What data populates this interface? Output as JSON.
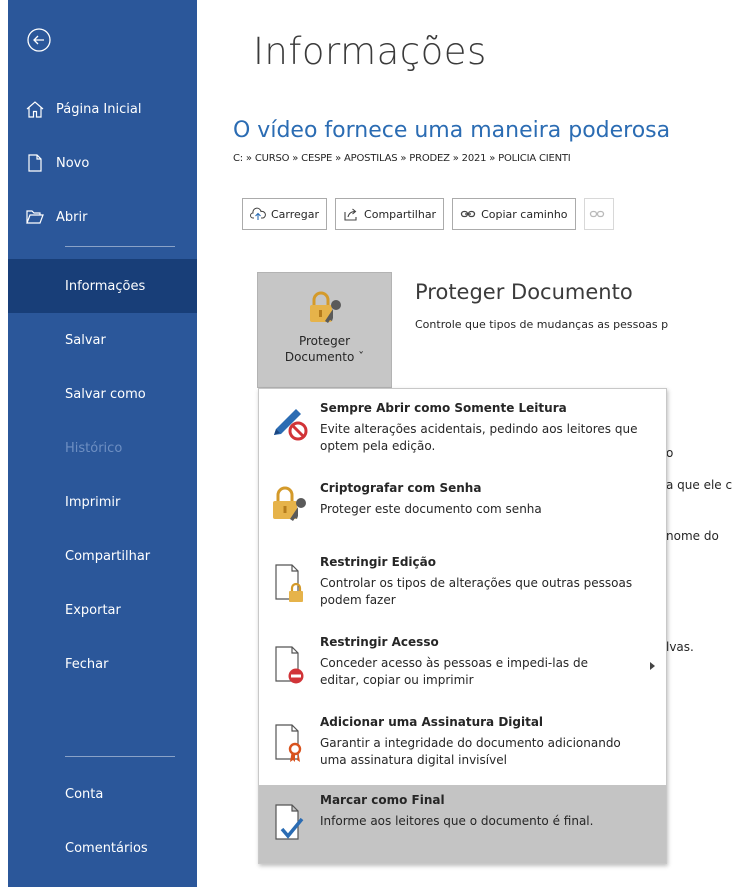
{
  "sidebar": {
    "back_icon": "back-arrow-icon",
    "top_items": [
      {
        "label": "Página Inicial",
        "icon": "home-icon"
      },
      {
        "label": "Novo",
        "icon": "new-document-icon"
      },
      {
        "label": "Abrir",
        "icon": "open-folder-icon"
      }
    ],
    "items": [
      {
        "label": "Informações",
        "active": true
      },
      {
        "label": "Salvar"
      },
      {
        "label": "Salvar como"
      },
      {
        "label": "Histórico",
        "disabled": true
      },
      {
        "label": "Imprimir"
      },
      {
        "label": "Compartilhar"
      },
      {
        "label": "Exportar"
      },
      {
        "label": "Fechar"
      }
    ],
    "bottom_items": [
      {
        "label": "Conta"
      },
      {
        "label": "Comentários"
      }
    ],
    "color": "#2b579a",
    "active_color": "#183e78"
  },
  "main": {
    "page_title": "Informações",
    "doc_title": "O vídeo fornece uma maneira poderosa",
    "doc_path": "C: » CURSO » CESPE » APOSTILAS » PRODEZ » 2021 » POLICIA CIENTI",
    "toolbar": {
      "upload": "Carregar",
      "share": "Compartilhar",
      "copy_path": "Copiar caminho"
    },
    "protect": {
      "button_label_1": "Proteger",
      "button_label_2": "Documento ˇ",
      "section_title": "Proteger Documento",
      "section_desc": "Controle que tipos de mudanças as pessoas p"
    },
    "background_fragments": {
      "a": "o",
      "b": "a que ele c",
      "c": "nome do",
      "d": "lvas."
    }
  },
  "menu": {
    "items": [
      {
        "title": "Sempre Abrir como Somente Leitura",
        "desc": "Evite alterações acidentais, pedindo aos leitores que optem pela edição.",
        "icon": "pencil-prohibited-icon"
      },
      {
        "title": "Criptografar com Senha",
        "desc": "Proteger este documento com senha",
        "icon": "lock-key-icon"
      },
      {
        "title": "Restringir Edição",
        "desc": "Controlar os tipos de alterações que outras pessoas podem fazer",
        "icon": "document-lock-icon"
      },
      {
        "title": "Restringir Acesso",
        "desc": "Conceder acesso às pessoas e impedi-las de editar, copiar ou imprimir",
        "icon": "document-restricted-icon",
        "has_submenu": true
      },
      {
        "title": "Adicionar uma Assinatura Digital",
        "desc": "Garantir a integridade do documento adicionando uma assinatura digital invisível",
        "icon": "document-ribbon-icon"
      },
      {
        "title": "Marcar como Final",
        "desc": "Informe aos leitores que o documento é final.",
        "icon": "document-check-icon",
        "highlighted": true
      }
    ]
  }
}
